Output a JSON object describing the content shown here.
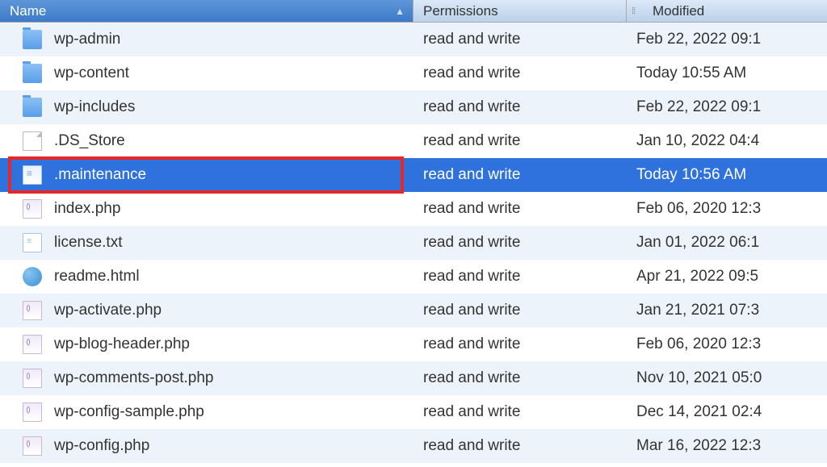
{
  "columns": {
    "name": "Name",
    "permissions": "Permissions",
    "modified": "Modified"
  },
  "files": [
    {
      "name": "wp-admin",
      "permissions": "read and write",
      "modified": "Feb 22, 2022 09:1",
      "type": "folder",
      "selected": false,
      "highlighted": false
    },
    {
      "name": "wp-content",
      "permissions": "read and write",
      "modified": "Today 10:55 AM",
      "type": "folder",
      "selected": false,
      "highlighted": false
    },
    {
      "name": "wp-includes",
      "permissions": "read and write",
      "modified": "Feb 22, 2022 09:1",
      "type": "folder",
      "selected": false,
      "highlighted": false
    },
    {
      "name": ".DS_Store",
      "permissions": "read and write",
      "modified": "Jan 10, 2022 04:4",
      "type": "file-generic",
      "selected": false,
      "highlighted": false
    },
    {
      "name": ".maintenance",
      "permissions": "read and write",
      "modified": "Today 10:56 AM",
      "type": "file-doc",
      "selected": true,
      "highlighted": true
    },
    {
      "name": "index.php",
      "permissions": "read and write",
      "modified": "Feb 06, 2020 12:3",
      "type": "file-php",
      "selected": false,
      "highlighted": false
    },
    {
      "name": "license.txt",
      "permissions": "read and write",
      "modified": "Jan 01, 2022 06:1",
      "type": "file-txt",
      "selected": false,
      "highlighted": false
    },
    {
      "name": "readme.html",
      "permissions": "read and write",
      "modified": "Apr 21, 2022 09:5",
      "type": "file-html",
      "selected": false,
      "highlighted": false
    },
    {
      "name": "wp-activate.php",
      "permissions": "read and write",
      "modified": "Jan 21, 2021 07:3",
      "type": "file-php",
      "selected": false,
      "highlighted": false
    },
    {
      "name": "wp-blog-header.php",
      "permissions": "read and write",
      "modified": "Feb 06, 2020 12:3",
      "type": "file-php",
      "selected": false,
      "highlighted": false
    },
    {
      "name": "wp-comments-post.php",
      "permissions": "read and write",
      "modified": "Nov 10, 2021 05:0",
      "type": "file-php",
      "selected": false,
      "highlighted": false
    },
    {
      "name": "wp-config-sample.php",
      "permissions": "read and write",
      "modified": "Dec 14, 2021 02:4",
      "type": "file-php",
      "selected": false,
      "highlighted": false
    },
    {
      "name": "wp-config.php",
      "permissions": "read and write",
      "modified": "Mar 16, 2022 12:3",
      "type": "file-php",
      "selected": false,
      "highlighted": false
    }
  ]
}
